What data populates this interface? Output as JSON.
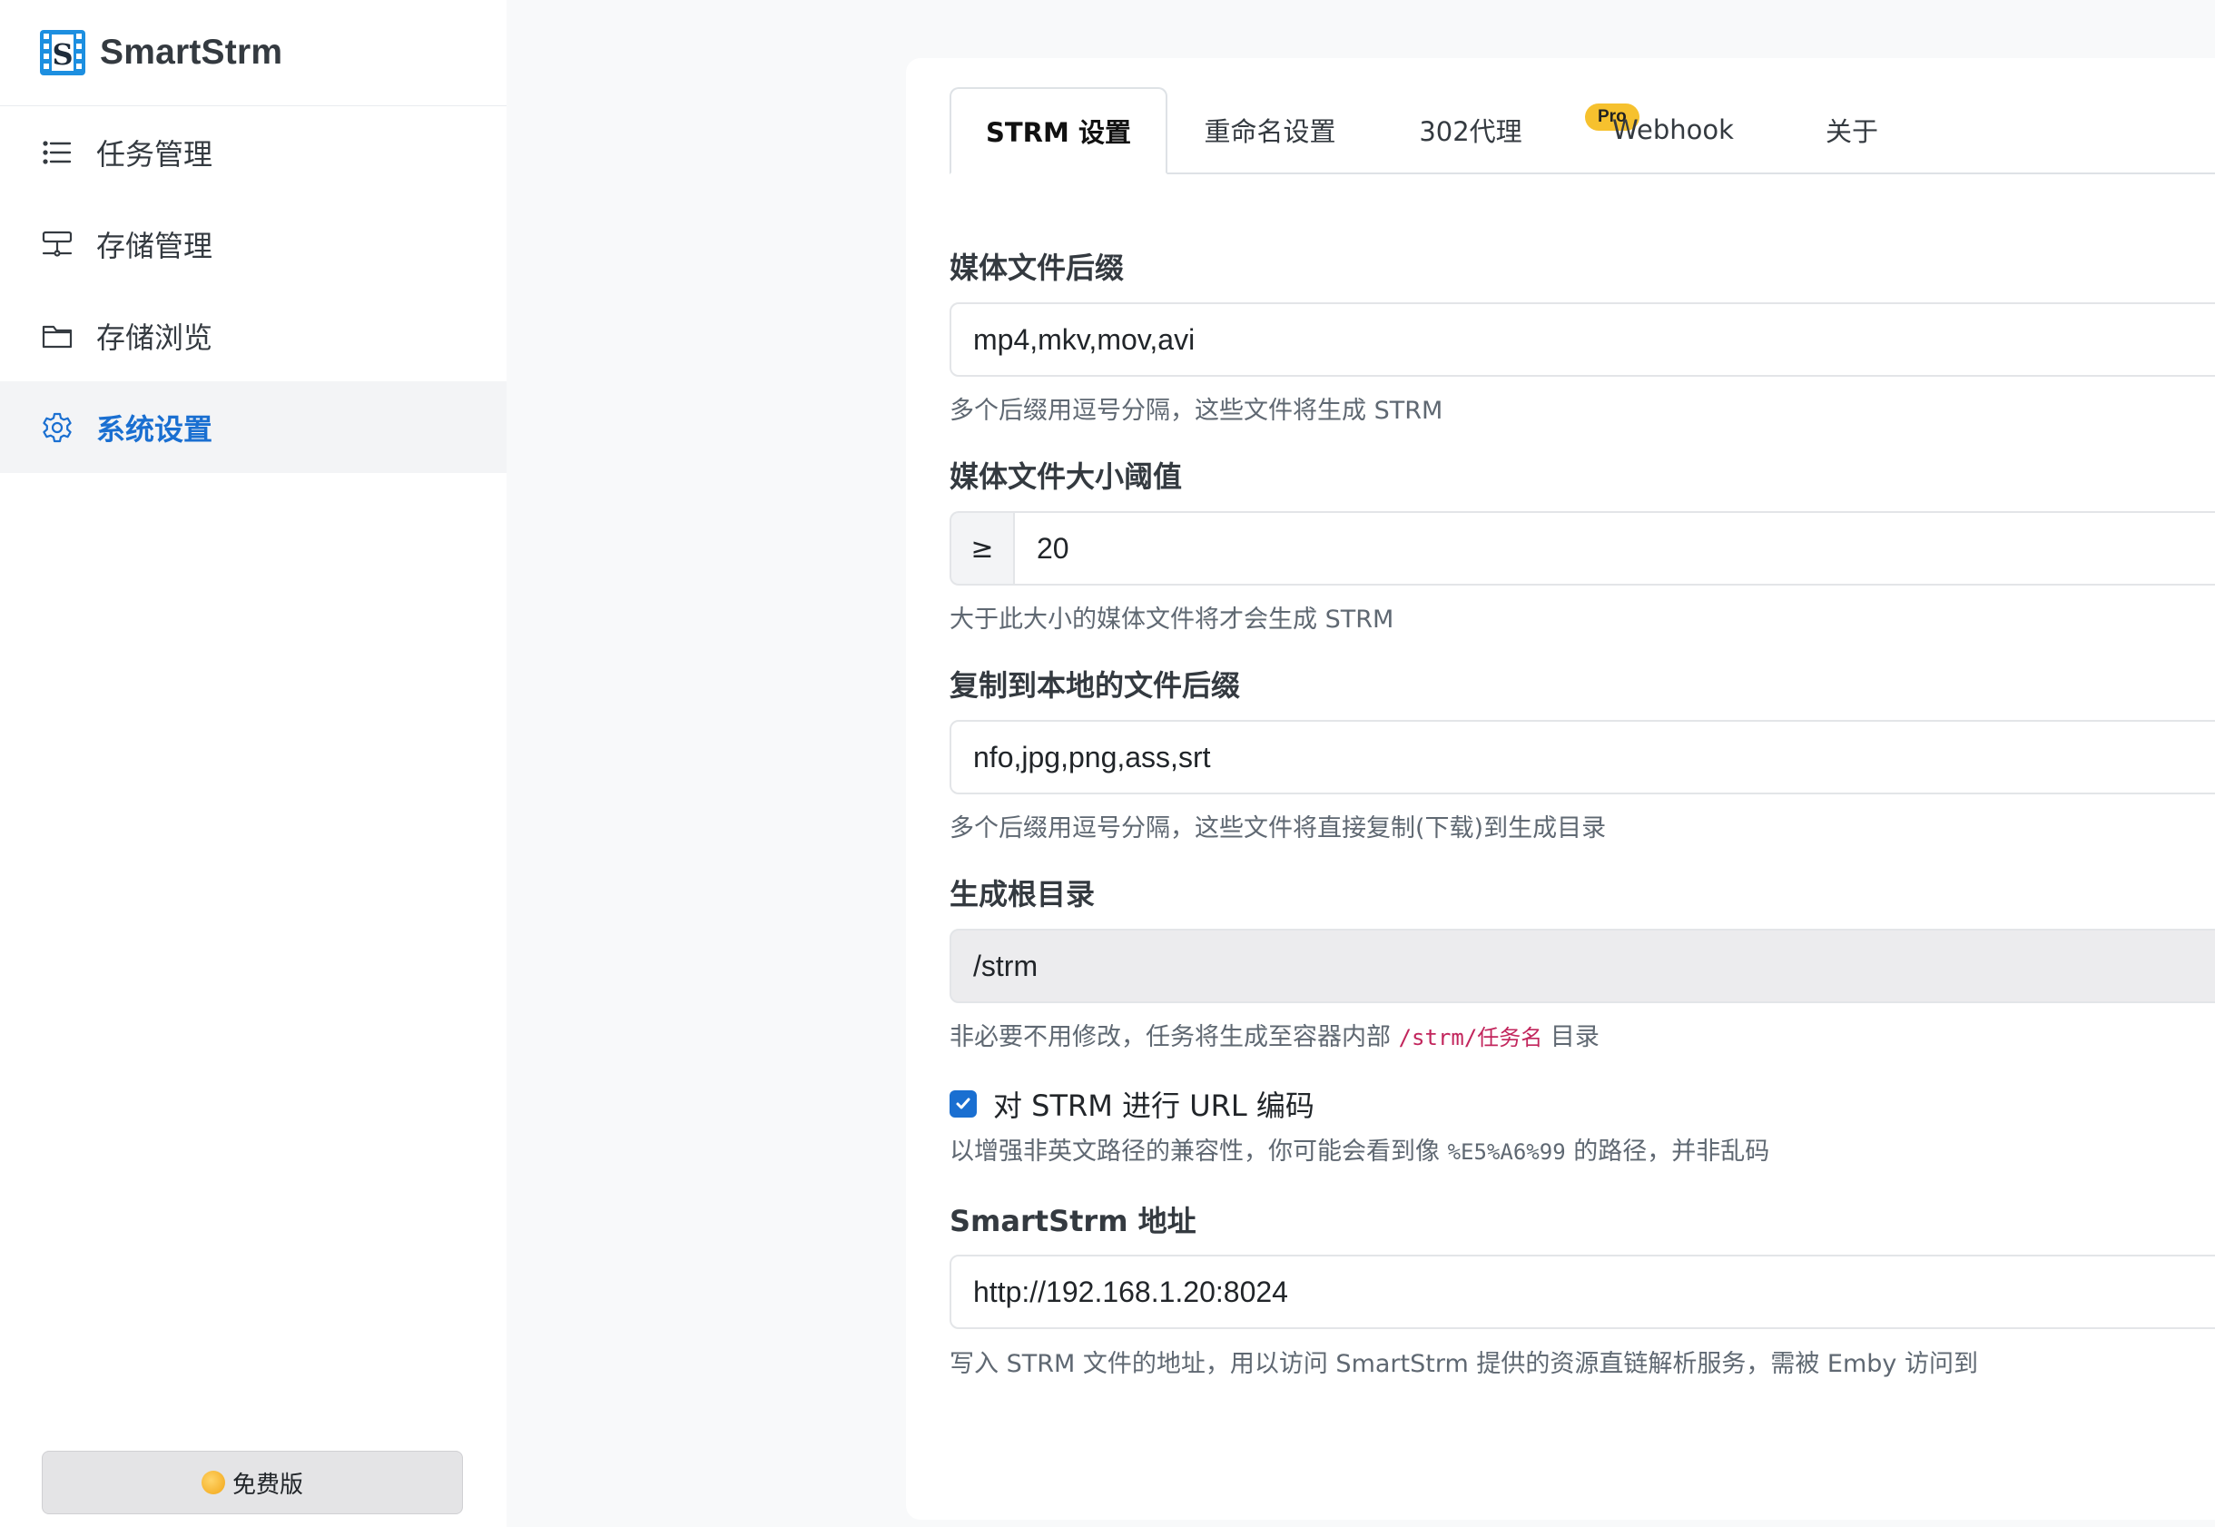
{
  "brand": {
    "name": "SmartStrm",
    "logo_letter": "S"
  },
  "sidebar": {
    "items": [
      {
        "label": "任务管理",
        "icon": "list-icon",
        "active": false
      },
      {
        "label": "存储管理",
        "icon": "storage-icon",
        "active": false
      },
      {
        "label": "存储浏览",
        "icon": "folder-icon",
        "active": false
      },
      {
        "label": "系统设置",
        "icon": "gear-icon",
        "active": true
      }
    ],
    "footer_label": "免费版"
  },
  "tabs": {
    "items": [
      {
        "label": "STRM 设置",
        "active": true
      },
      {
        "label": "重命名设置",
        "active": false
      },
      {
        "label": "302代理",
        "active": false
      },
      {
        "label": "Webhook",
        "active": false
      },
      {
        "label": "关于",
        "active": false
      }
    ],
    "pro_badge": "Pro"
  },
  "form": {
    "media_ext": {
      "label": "媒体文件后缀",
      "value": "mp4,mkv,mov,avi",
      "help": "多个后缀用逗号分隔，这些文件将生成 STRM"
    },
    "media_size": {
      "label": "媒体文件大小阈值",
      "prefix": "≥",
      "value": "20",
      "help": "大于此大小的媒体文件将才会生成 STRM"
    },
    "copy_ext": {
      "label": "复制到本地的文件后缀",
      "value": "nfo,jpg,png,ass,srt",
      "help": "多个后缀用逗号分隔，这些文件将直接复制(下载)到生成目录"
    },
    "root_dir": {
      "label": "生成根目录",
      "value": "/strm",
      "help_before": "非必要不用修改，任务将生成至容器内部",
      "help_code": "/strm/任务名",
      "help_after": "目录"
    },
    "url_encode": {
      "label": "对 STRM 进行 URL 编码",
      "checked": true,
      "help_before": "以增强非英文路径的兼容性，你可能会看到像",
      "help_code": "%E5%A6%99",
      "help_after": "的路径，并非乱码"
    },
    "address": {
      "label": "SmartStrm 地址",
      "value": "http://192.168.1.20:8024",
      "help": "写入 STRM 文件的地址，用以访问 SmartStrm 提供的资源直链解析服务，需被 Emby 访问到"
    }
  },
  "colors": {
    "accent": "#1a6fd1",
    "pro_badge": "#f6c12e",
    "code_pink": "#c2255c",
    "sidebar_active_bg": "#f3f4f6"
  }
}
